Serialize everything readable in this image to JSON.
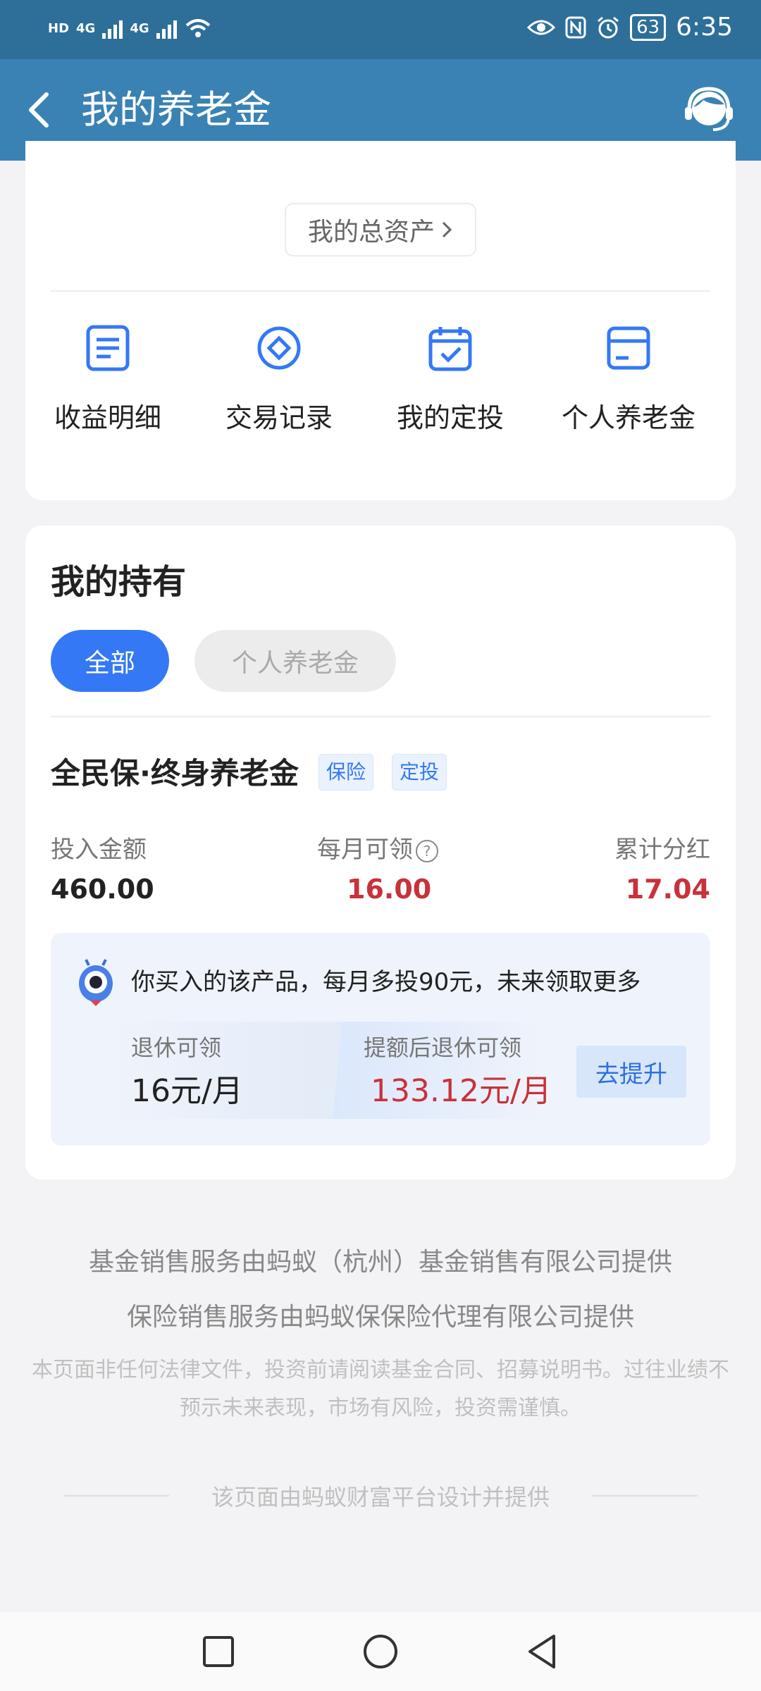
{
  "status_bar": {
    "time": "6:35",
    "battery": "63",
    "net1": "4G",
    "net2": "4G",
    "hd": "HD"
  },
  "header": {
    "title": "我的养老金"
  },
  "assets": {
    "total_assets_label": "我的总资产",
    "quick_actions": [
      {
        "label": "收益明细",
        "icon": "document-icon"
      },
      {
        "label": "交易记录",
        "icon": "coin-icon"
      },
      {
        "label": "我的定投",
        "icon": "calendar-check-icon"
      },
      {
        "label": "个人养老金",
        "icon": "card-icon"
      }
    ]
  },
  "holdings": {
    "title": "我的持有",
    "tabs": [
      "全部",
      "个人养老金"
    ],
    "product": {
      "name": "全民保·终身养老金",
      "tags": [
        "保险",
        "定投"
      ],
      "invest_label": "投入金额",
      "invest_value": "460.00",
      "monthly_label": "每月可领",
      "monthly_value": "16.00",
      "dividend_label": "累计分红",
      "dividend_value": "17.04"
    },
    "promo": {
      "text": "你买入的该产品，每月多投90元，未来领取更多",
      "retire_label": "退休可领",
      "retire_value": "16元/月",
      "boost_label": "提额后退休可领",
      "boost_value": "133.12元/月",
      "button": "去提升"
    }
  },
  "footer": {
    "line1": "基金销售服务由蚂蚁（杭州）基金销售有限公司提供",
    "line2": "保险销售服务由蚂蚁保保险代理有限公司提供",
    "disclaimer": "本页面非任何法律文件，投资前请阅读基金合同、招募说明书。过往业绩不预示未来表现，市场有风险，投资需谨慎。",
    "platform": "该页面由蚂蚁财富平台设计并提供"
  },
  "colors": {
    "header_bg": "#3b82b4",
    "accent_blue": "#3478f6",
    "value_red": "#c8323a"
  }
}
